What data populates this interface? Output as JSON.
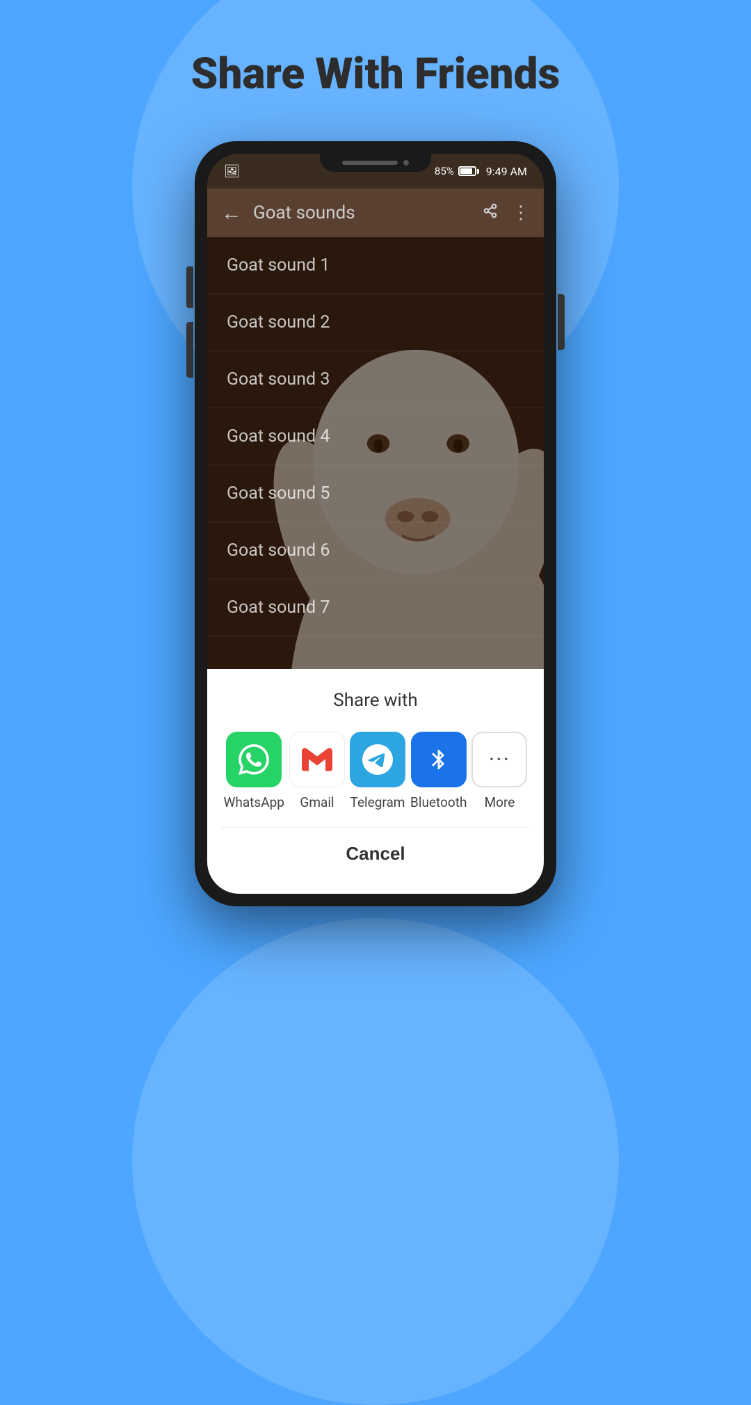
{
  "page": {
    "title": "Share With Friends",
    "background_color": "#4da6ff"
  },
  "status_bar": {
    "time": "9:49 AM",
    "battery_pct": "85%"
  },
  "app_bar": {
    "title": "Goat sounds",
    "back_label": "←",
    "share_icon": "share",
    "more_icon": "⋮"
  },
  "sound_list": {
    "items": [
      {
        "label": "Goat sound 1"
      },
      {
        "label": "Goat sound 2"
      },
      {
        "label": "Goat sound 3"
      },
      {
        "label": "Goat sound 4"
      },
      {
        "label": "Goat sound 5"
      },
      {
        "label": "Goat sound 6"
      },
      {
        "label": "Goat sound 7"
      }
    ]
  },
  "share_sheet": {
    "title": "Share with",
    "apps": [
      {
        "id": "whatsapp",
        "label": "WhatsApp",
        "icon": "💬",
        "color": "#25d366"
      },
      {
        "id": "gmail",
        "label": "Gmail",
        "icon": "✉",
        "color": "#fff"
      },
      {
        "id": "telegram",
        "label": "Telegram",
        "icon": "✈",
        "color": "#2ca5e0"
      },
      {
        "id": "bluetooth",
        "label": "Bluetooth",
        "icon": "⚡",
        "color": "#1a73e8"
      },
      {
        "id": "more",
        "label": "More",
        "icon": "···",
        "color": "#fff"
      }
    ],
    "cancel_label": "Cancel"
  }
}
